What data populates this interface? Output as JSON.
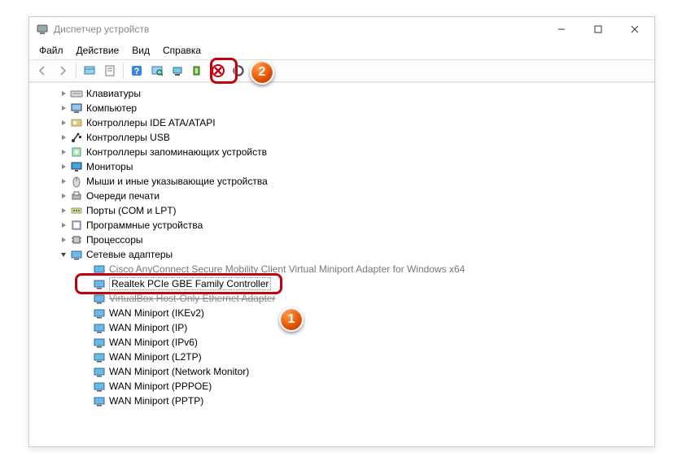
{
  "window": {
    "title": "Диспетчер устройств"
  },
  "menu": {
    "file": "Файл",
    "action": "Действие",
    "view": "Вид",
    "help": "Справка"
  },
  "toolbar_icons": {
    "back": "back-icon",
    "forward": "forward-icon",
    "show_hidden": "show-hidden-icon",
    "properties": "properties-icon",
    "help": "help-icon",
    "scan": "scan-icon",
    "update": "update-driver-icon",
    "uninstall": "uninstall-icon",
    "disable": "disable-icon",
    "enable": "enable-icon"
  },
  "tree": {
    "categories": [
      {
        "label": "Клавиатуры",
        "icon": "keyboard",
        "expanded": false
      },
      {
        "label": "Компьютер",
        "icon": "computer",
        "expanded": false
      },
      {
        "label": "Контроллеры IDE ATA/ATAPI",
        "icon": "ide",
        "expanded": false
      },
      {
        "label": "Контроллеры USB",
        "icon": "usb",
        "expanded": false
      },
      {
        "label": "Контроллеры запоминающих устройств",
        "icon": "storage",
        "expanded": false
      },
      {
        "label": "Мониторы",
        "icon": "monitor",
        "expanded": false
      },
      {
        "label": "Мыши и иные указывающие устройства",
        "icon": "mouse",
        "expanded": false
      },
      {
        "label": "Очереди печати",
        "icon": "printer",
        "expanded": false
      },
      {
        "label": "Порты (COM и LPT)",
        "icon": "port",
        "expanded": false
      },
      {
        "label": "Программные устройства",
        "icon": "software",
        "expanded": false
      },
      {
        "label": "Процессоры",
        "icon": "cpu",
        "expanded": false
      },
      {
        "label": "Сетевые адаптеры",
        "icon": "network",
        "expanded": true,
        "children": [
          {
            "label": "Cisco AnyConnect Secure Mobility Client Virtual Miniport Adapter for Windows x64",
            "dim": true
          },
          {
            "label": "Realtek PCIe GBE Family Controller",
            "selected": true
          },
          {
            "label": "VirtualBox Host-Only Ethernet Adapter",
            "covered": true
          },
          {
            "label": "WAN Miniport (IKEv2)"
          },
          {
            "label": "WAN Miniport (IP)"
          },
          {
            "label": "WAN Miniport (IPv6)"
          },
          {
            "label": "WAN Miniport (L2TP)"
          },
          {
            "label": "WAN Miniport (Network Monitor)"
          },
          {
            "label": "WAN Miniport (PPPOE)"
          },
          {
            "label": "WAN Miniport (PPTP)"
          }
        ]
      }
    ]
  },
  "callouts": {
    "one": "1",
    "two": "2"
  }
}
